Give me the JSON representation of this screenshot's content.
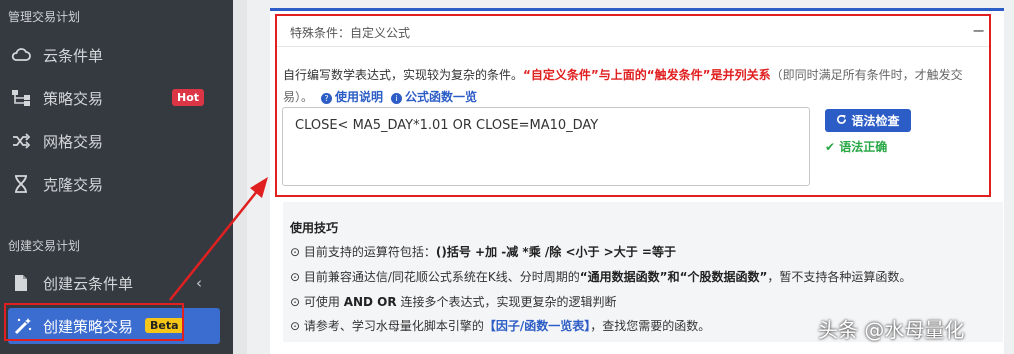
{
  "sidebar": {
    "section1": "管理交易计划",
    "items": [
      {
        "label": "云条件单",
        "icon": "cloud-icon"
      },
      {
        "label": "策略交易",
        "icon": "hierarchy-icon",
        "badge": "Hot"
      },
      {
        "label": "网格交易",
        "icon": "shuffle-icon"
      },
      {
        "label": "克隆交易",
        "icon": "hourglass-icon"
      }
    ],
    "section2": "创建交易计划",
    "create_items": [
      {
        "label": "创建云条件单",
        "icon": "file-icon",
        "chevron": "‹"
      },
      {
        "label": "创建策略交易",
        "icon": "magic-wand-icon",
        "badge": "Beta"
      }
    ]
  },
  "panel": {
    "title": "特殊条件：自定义公式",
    "collapse": "−",
    "desc_part1": "自行编写数学表达式，实现较为复杂的条件。",
    "desc_red": "“自定义条件”与上面的“触发条件”是并列关系",
    "desc_part2": "（即同时满足所有条件时，才触发交易）。",
    "help_link": "使用说明",
    "func_link": "公式函数一览",
    "formula": "CLOSE< MA5_DAY*1.01 OR CLOSE=MA10_DAY",
    "check_button": "语法检查",
    "check_result": "语法正确"
  },
  "tips": {
    "title": "使用技巧",
    "items": [
      {
        "prefix": "目前支持的运算符包括：",
        "bold": "()括号 +加 -减 *乘 /除 <小于 >大于 =等于",
        "suffix": ""
      },
      {
        "prefix": "目前兼容通达信/同花顺公式系统在K线、分时周期的",
        "bold": "“通用数据函数”和“个股数据函数”",
        "suffix": "，暂不支持各种运算函数。"
      },
      {
        "prefix": "可使用 ",
        "bold": "AND OR",
        "suffix": " 连接多个表达式，实现更复杂的逻辑判断"
      },
      {
        "prefix": "请参考、学习水母量化脚本引擎的",
        "link": "【因子/函数一览表】",
        "suffix": "，查找您需要的函数。"
      }
    ]
  },
  "watermark": "头条 @水母量化",
  "colors": {
    "sidebar_bg": "#343a40",
    "accent": "#2c5cc5",
    "highlight_red": "#e02020",
    "success": "#28a745",
    "hot_badge": "#dc3545",
    "beta_badge": "#f5c518"
  }
}
